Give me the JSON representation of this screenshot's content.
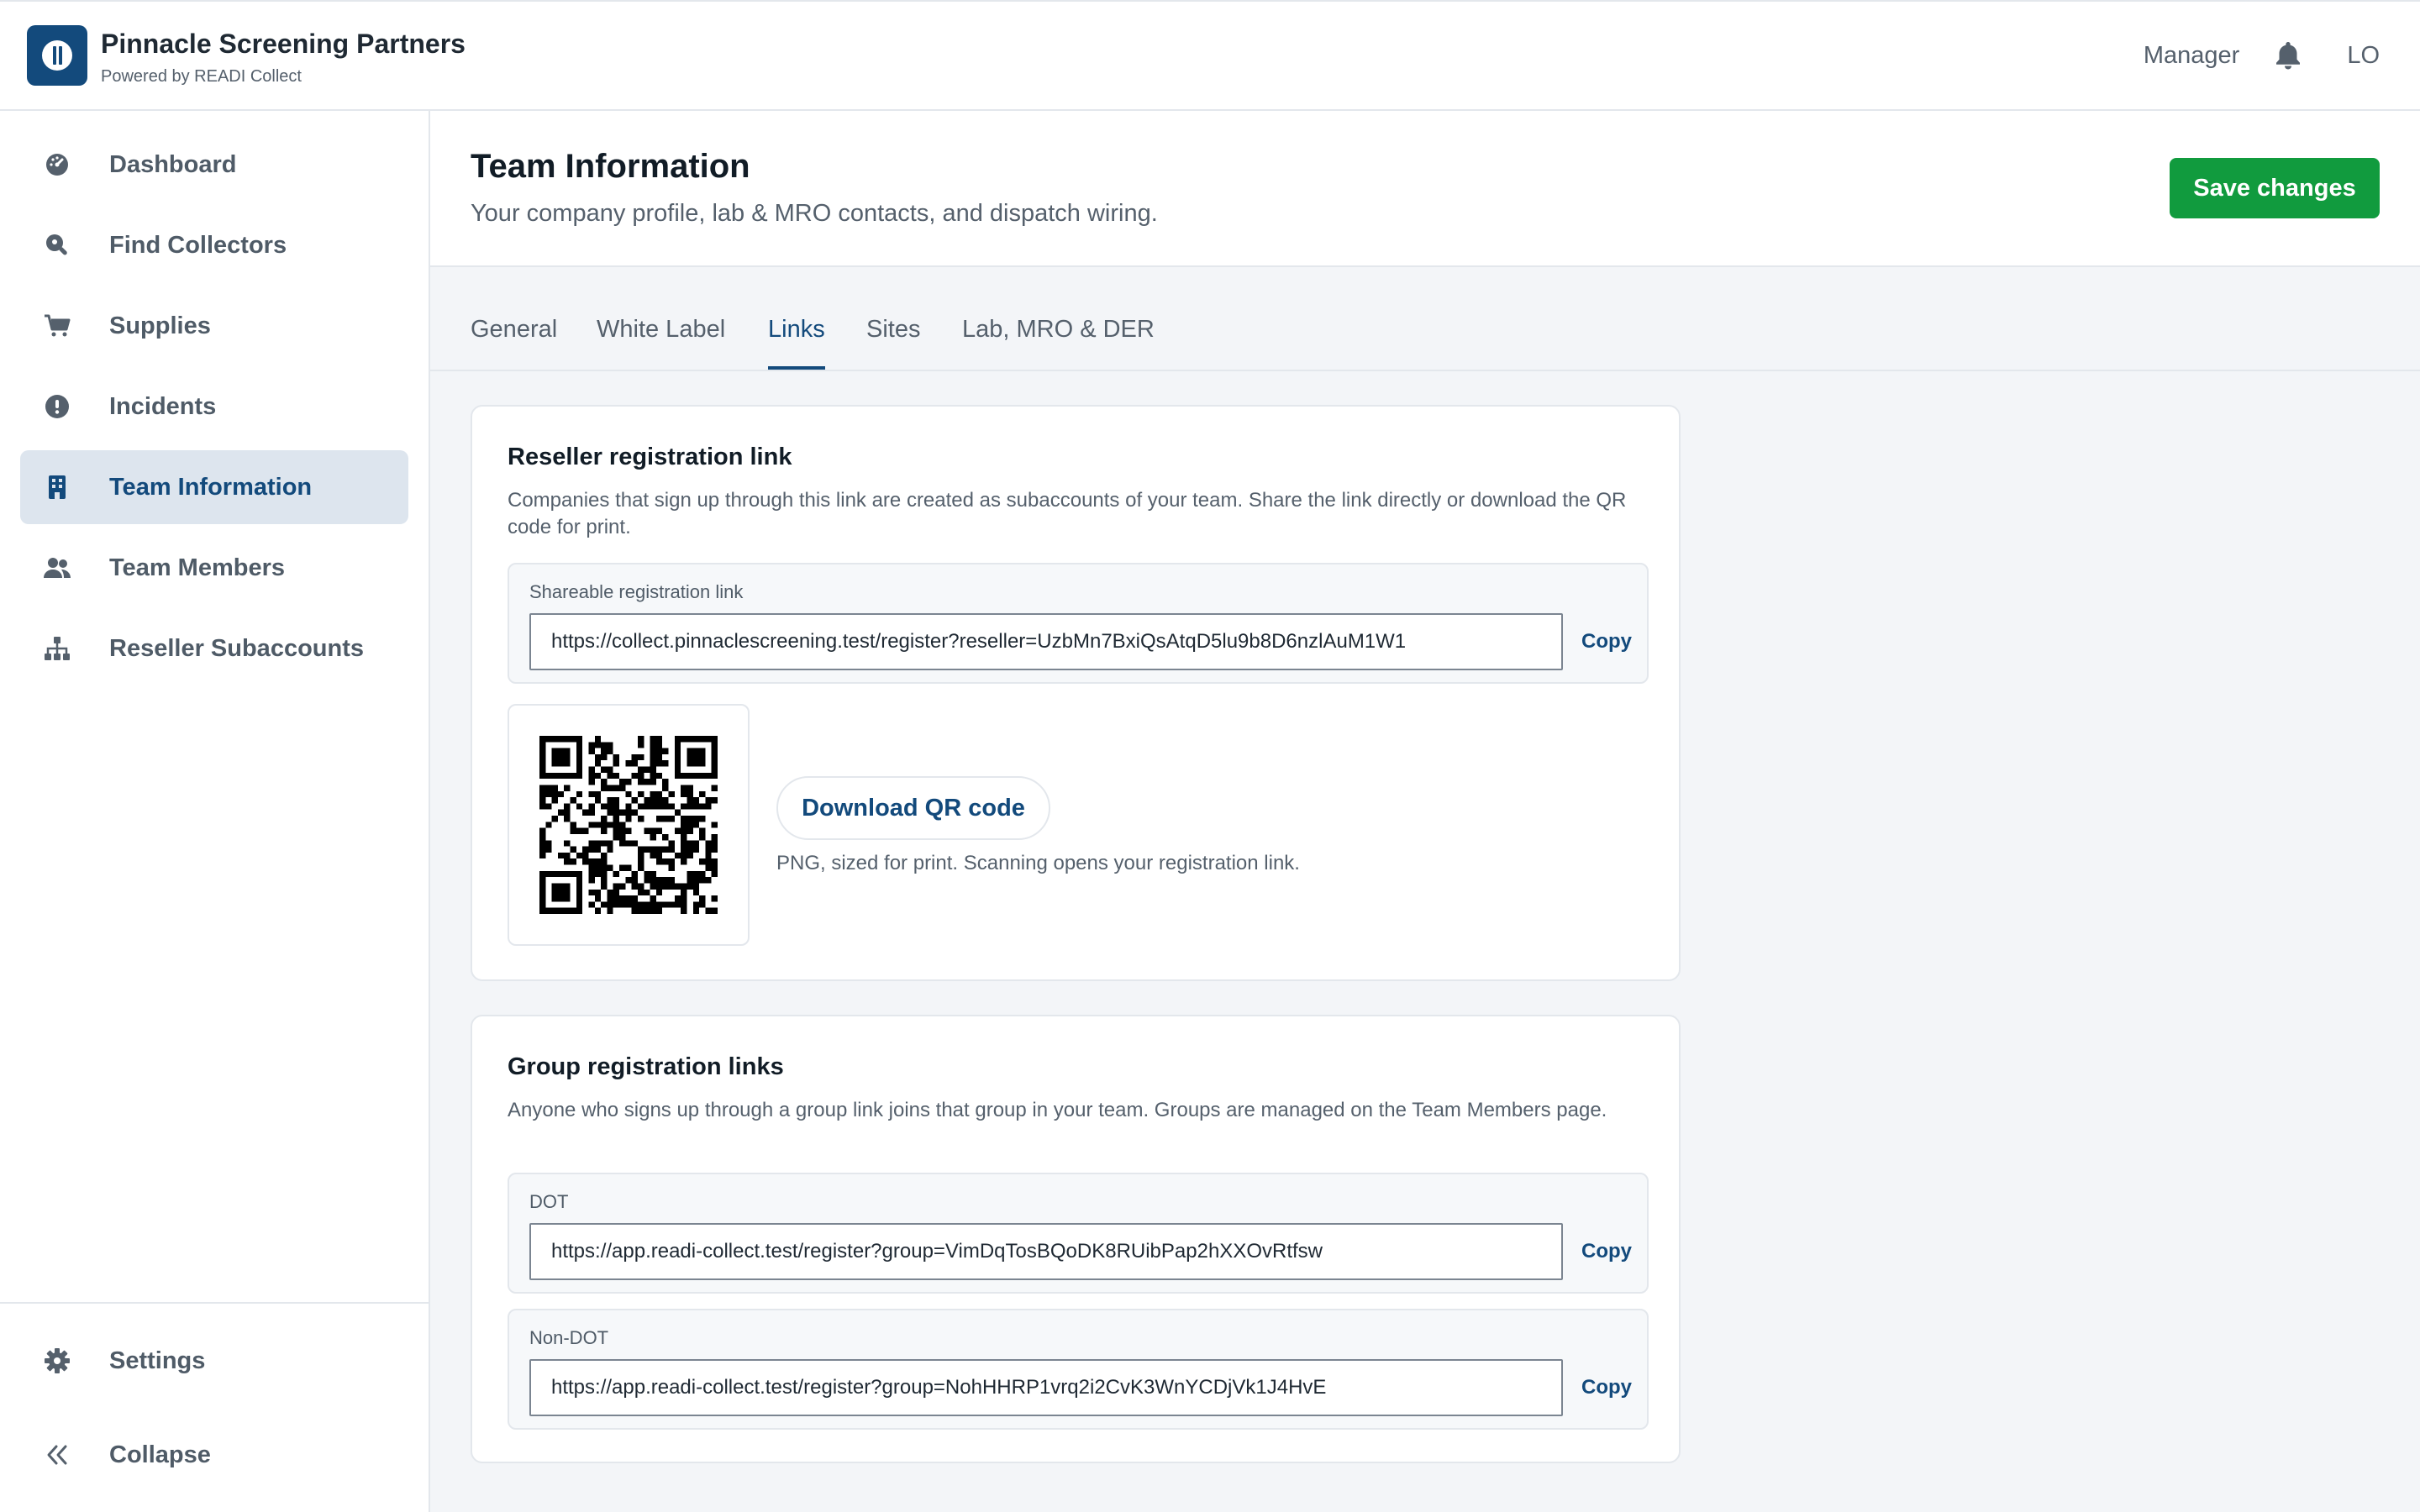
{
  "app": {
    "title": "Pinnacle Screening Partners",
    "subtitle": "Powered by READI Collect",
    "logo_icon": "pause-circle-logo-icon",
    "brand_color": "#134a7c"
  },
  "topbar": {
    "role": "Manager",
    "notifications_icon": "bell-icon",
    "user_initials": "LO"
  },
  "sidebar": {
    "items": [
      {
        "label": "Dashboard",
        "icon": "gauge-icon"
      },
      {
        "label": "Find Collectors",
        "icon": "search-location-icon"
      },
      {
        "label": "Supplies",
        "icon": "cart-icon"
      },
      {
        "label": "Incidents",
        "icon": "alert-circle-icon"
      },
      {
        "label": "Team Information",
        "icon": "building-icon",
        "active": true
      },
      {
        "label": "Team Members",
        "icon": "users-icon"
      },
      {
        "label": "Reseller Subaccounts",
        "icon": "hierarchy-icon"
      }
    ],
    "bottom": [
      {
        "label": "Settings",
        "icon": "gear-icon"
      },
      {
        "label": "Collapse",
        "icon": "double-chevron-left-icon"
      }
    ]
  },
  "header": {
    "title": "Team Information",
    "subtitle": "Your company profile, lab & MRO contacts, and dispatch wiring.",
    "save_label": "Save changes",
    "save_color": "#119b3e"
  },
  "tabs": [
    {
      "label": "General"
    },
    {
      "label": "White Label"
    },
    {
      "label": "Links",
      "active": true
    },
    {
      "label": "Sites"
    },
    {
      "label": "Lab, MRO & DER"
    }
  ],
  "reseller": {
    "title": "Reseller registration link",
    "description": "Companies that sign up through this link are created as subaccounts of your team. Share the link directly or download the QR code for print.",
    "link_label": "Shareable registration link",
    "link_value": "https://collect.pinnaclescreening.test/register?reseller=UzbMn7BxiQsAtqD5lu9b8D6nzlAuM1W1",
    "copy_label": "Copy",
    "qr_button": "Download QR code",
    "qr_note": "PNG, sized for print. Scanning opens your registration link."
  },
  "groups": {
    "title": "Group registration links",
    "description": "Anyone who signs up through a group link joins that group in your team. Groups are managed on the Team Members page.",
    "links": [
      {
        "label": "DOT",
        "value": "https://app.readi-collect.test/register?group=VimDqTosBQoDK8RUibPap2hXXOvRtfsw",
        "copy_label": "Copy"
      },
      {
        "label": "Non-DOT",
        "value": "https://app.readi-collect.test/register?group=NohHHRP1vrq2i2CvK3WnYCDjVk1J4HvE",
        "copy_label": "Copy"
      }
    ]
  }
}
